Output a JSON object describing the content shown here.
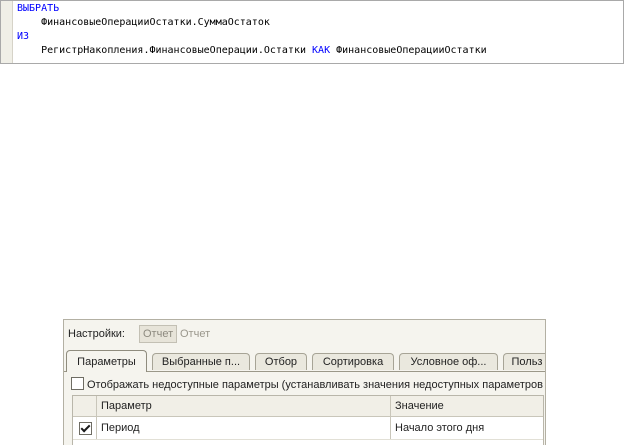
{
  "query": {
    "lines": [
      {
        "indent": "",
        "keyword": "ВЫБРАТЬ",
        "text": ""
      },
      {
        "indent": "    ",
        "keyword": "",
        "text": "ФинансовыеОперацииОстатки.СуммаОстаток"
      },
      {
        "indent": "",
        "keyword": "ИЗ",
        "text": ""
      },
      {
        "indent": "    ",
        "keyword": "",
        "text": "РегистрНакопления.ФинансовыеОперации.Остатки",
        "keyword2": "КАК",
        "text2": "ФинансовыеОперацииОстатки"
      }
    ],
    "keyword_color": "#0000ff"
  },
  "settings": {
    "label": "Настройки:",
    "variant_selected": "Отчет",
    "variant_other": "Отчет",
    "tabs": [
      {
        "label": "Параметры",
        "active": true
      },
      {
        "label": "Выбранные п...",
        "active": false
      },
      {
        "label": "Отбор",
        "active": false
      },
      {
        "label": "Сортировка",
        "active": false
      },
      {
        "label": "Условное оф...",
        "active": false
      },
      {
        "label": "Польз",
        "active": false
      }
    ],
    "show_unavailable": {
      "label": "Отображать недоступные параметры (устанавливать значения недоступных параметров",
      "checked": false
    },
    "table": {
      "headers": [
        "Параметр",
        "Значение"
      ],
      "rows": [
        {
          "checked": true,
          "parameter": "Период",
          "value": "Начало этого дня"
        }
      ]
    }
  }
}
